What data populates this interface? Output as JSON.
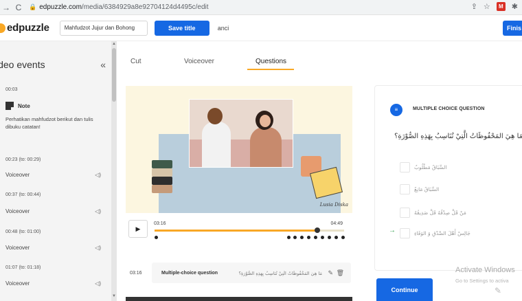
{
  "browser": {
    "back": "←",
    "forward": "→",
    "reload": "C",
    "url_host": "edpuzzle.com",
    "url_path": "/media/6384929a8e92704124d4495c/edit",
    "ext_label": "M"
  },
  "header": {
    "logo": "edpuzzle",
    "title_value": "Mahfudzot Jujur dan Bohong",
    "save_title": "Save title",
    "cancel": "anci",
    "finish": "Finis"
  },
  "sidebar": {
    "title": "ideo events",
    "collapse": "«",
    "note_time": "00:03",
    "note_label": "Note",
    "note_text": "Perhatikan mahfudzot berikut dan tulis dibuku catatan!",
    "events": [
      {
        "range": "00:23 (to: 00:29)",
        "label": "Voiceover"
      },
      {
        "range": "00:37 (to: 00:44)",
        "label": "Voiceover"
      },
      {
        "range": "00:48 (to: 01:00)",
        "label": "Voiceover"
      },
      {
        "range": "01:07 (to: 01:18)",
        "label": "Voiceover"
      }
    ]
  },
  "tabs": [
    {
      "label": "Cut",
      "active": false
    },
    {
      "label": "Voiceover",
      "active": false
    },
    {
      "label": "Questions",
      "active": true
    }
  ],
  "video": {
    "signature": "Lusia Diska"
  },
  "player": {
    "current_time": "03:16",
    "total_time": "04:49",
    "progress": 0.86
  },
  "question_row": {
    "time": "03:16",
    "type": "Multiple-choice question",
    "text": "مَا هِيَ المَحْفُوظَاتُ الَّتِيْ تُنَاسِبُ بِهَذِهِ الصُّوْرَةِ؟"
  },
  "question_panel": {
    "type_label": "MULTIPLE CHOICE QUESTION",
    "question": "مَا هِيَ المَحْفُوظَاتُ الَّتِيْ تُنَاسِبُ بِهَذِهِ الصُّوْرَةِ؟",
    "answers": [
      {
        "text": "السِّبَاقُ مَطْلُوبٌ",
        "correct": false
      },
      {
        "text": "السِّبَاقُ مَانِعٌ",
        "correct": false
      },
      {
        "text": "مَنْ قَلَّ صِدْقُهُ قَلَّ صَدِيقُهُ",
        "correct": false
      },
      {
        "text": "جَالِسْ أَهْلَ الصِّدْقِ وَ الوَفَاءِ",
        "correct": true
      }
    ],
    "correct_marker": "→",
    "continue": "Continue"
  },
  "watermark": {
    "title": "Activate Windows",
    "subtitle": "Go to Settings to activa"
  },
  "colors": {
    "accent_blue": "#1668e3",
    "accent_yellow": "#f9a825",
    "correct_green": "#2e9d4a"
  }
}
